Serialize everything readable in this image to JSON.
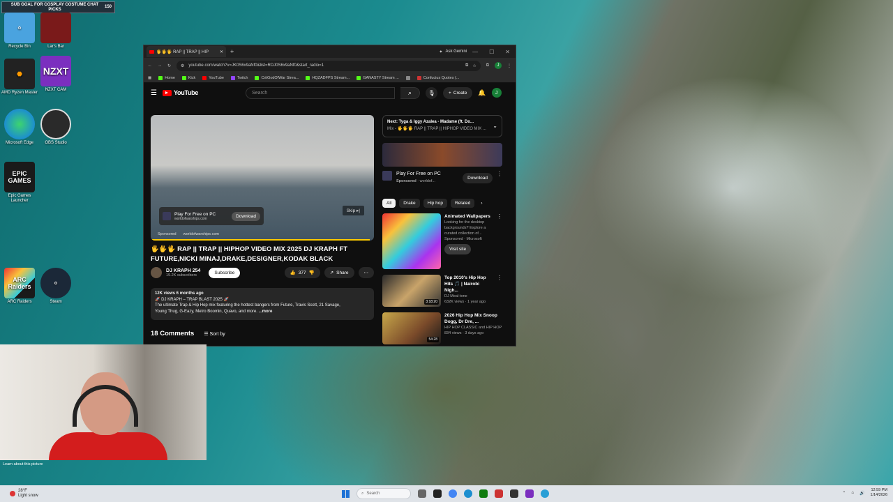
{
  "stream": {
    "goal": "SUB GOAL FOR COSPLAY COSTUME CHAT PICKS",
    "count": "150"
  },
  "desktop": {
    "icons": [
      {
        "label": "Recycle Bin",
        "color": "#4aa3df"
      },
      {
        "label": "Lar's Bar",
        "color": "#7a1a1a"
      },
      {
        "label": "AMD Ryzen Master",
        "color": "#222222"
      },
      {
        "label": "NZXT CAM",
        "glyph": "NZXT",
        "color": "#7b2fbf"
      },
      {
        "label": "Microsoft Edge",
        "color": "#1c8ecf"
      },
      {
        "label": "OBS Studio",
        "color": "#2a2a2a"
      },
      {
        "label": "Epic Games Launcher",
        "glyph": "EPIC GAMES",
        "color": "#1a1a1a"
      },
      {
        "label": "ARC Raiders",
        "glyph": "ARC Raiders",
        "color": "#1a1a1a"
      },
      {
        "label": "Steam",
        "color": "#1b2838"
      }
    ]
  },
  "browser": {
    "tab_title": "🖐🖐🖐 RAP || TRAP || HIP",
    "new_tab": "+",
    "gemini": "Ask Gemini",
    "url": "youtube.com/watch?v=JK0S6x9aNf0&list=RDJ0S6x9aNf0&start_radio=1",
    "profile_initial": "J",
    "bookmarks": [
      {
        "label": "Home",
        "color": "#53fc18"
      },
      {
        "label": "Kick",
        "color": "#53fc18"
      },
      {
        "label": "YouTube",
        "color": "#ff0000"
      },
      {
        "label": "Twitch",
        "color": "#9146ff"
      },
      {
        "label": "CritGodOfWar Strea...",
        "color": "#53fc18"
      },
      {
        "label": "HQZADFPS Stream...",
        "color": "#53fc18"
      },
      {
        "label": "GANASTY Stream ...",
        "color": "#53fc18"
      },
      {
        "label": "",
        "color": "#888888"
      },
      {
        "label": "Confucius Quotes (...",
        "color": "#cc3333"
      }
    ]
  },
  "youtube": {
    "logo_text": "YouTube",
    "search_placeholder": "Search",
    "create_label": "Create",
    "avatar_initial": "J",
    "player": {
      "ad_title": "Play For Free on PC",
      "ad_domain": "worldofwarships.com",
      "ad_button": "Download",
      "skip": "Skip",
      "sponsored": "Sponsored",
      "sponsored_domain": "worldofwarships.com",
      "progress": 0.98
    },
    "video_title": "🖐🖐🖐 RAP || TRAP || HIPHOP VIDEO MIX 2025 DJ KRAPH FT FUTURE,NICKI MINAJ,DRAKE,DESIGNER,KODAK BLACK",
    "channel_name": "DJ KRAPH 254",
    "channel_subs": "19.2K subscribers",
    "subscribe": "Subscribe",
    "likes": "377",
    "share": "Share",
    "description": {
      "stats": "12K views  6 months ago",
      "line1": "🚀 DJ KRAPH – TRAP BLAST 2025 🚀",
      "line2": "The ultimate Trap & Hip Hop mix featuring the hottest bangers from Future, Travis Scott, 21 Savage,",
      "line3": "Young Thug, G-Eazy, Metro Boomin, Quavo, and more.",
      "more": "...more"
    },
    "comments_count": "18 Comments",
    "sort_by": "Sort by",
    "next": {
      "title": "Next: Tyga & Iggy Azalea - Madame (ft. Do...",
      "sub": "Mix - 🖐🖐🖐 RAP || TRAP || HIPHOP VIDEO MIX ..."
    },
    "side_ad": {
      "title": "Play For Free on PC",
      "sponsored": "Sponsored",
      "domain": "worldof...",
      "button": "Download"
    },
    "chips": [
      "All",
      "Drake",
      "Hip hop",
      "Related"
    ],
    "recommendations": [
      {
        "title": "Animated Wallpapers",
        "desc": "Looking for the desktop backgrounds? Explore a curated collection of...",
        "meta": "Sponsored · Microsoft",
        "action": "Visit site",
        "thumb": "linear-gradient(135deg,#e33 0%,#f9c23c 25%,#3cd 50%,#a3e 75%,#f6a 100%)"
      },
      {
        "title": "Top 2010's Hip Hop Hits 🎵 | Nairobi Nigh...",
        "channel": "DJ Meal-tone",
        "meta": "632K views · 1 year ago",
        "duration": "3:18:20",
        "thumb": "linear-gradient(135deg,#2a2a2a 0%,#c9a46a 50%,#333 100%)"
      },
      {
        "title": "2026 Hip Hop Mix Snoop Dogg, Dr Dre, ...",
        "channel": "HIP HOP CLASSIC and HIP HOP",
        "meta": "834 views · 3 days ago",
        "duration": "54:28",
        "thumb": "linear-gradient(135deg,#c7a74a 0%,#7a4a2a 60%,#1a1a1a 100%)"
      }
    ]
  },
  "webcam": {
    "caption": "Learn about this picture"
  },
  "taskbar": {
    "weather_temp": "28°F",
    "weather_cond": "Light snow",
    "search": "Search",
    "time": "12:59 PM",
    "date": "1/14/2026"
  }
}
